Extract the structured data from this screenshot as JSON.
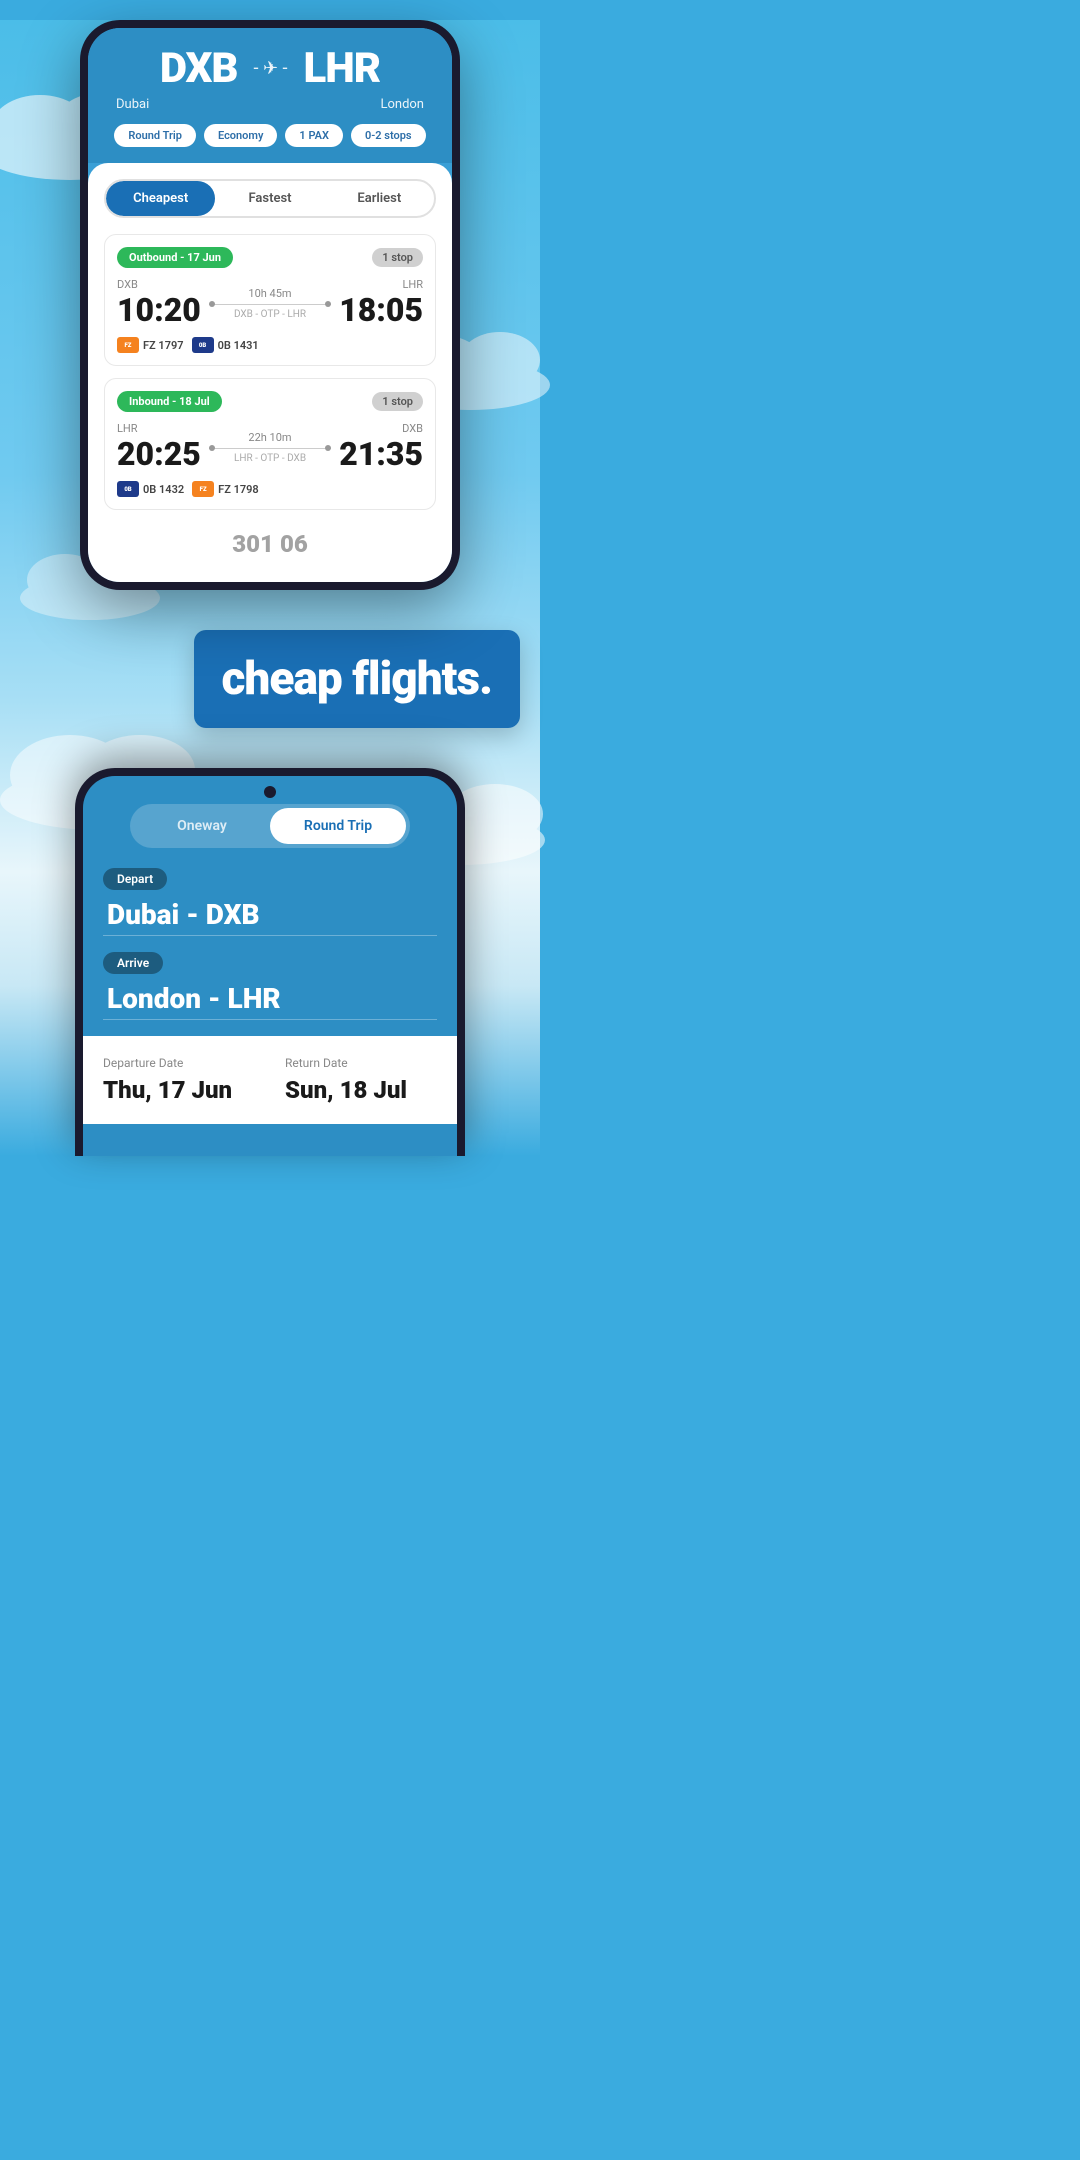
{
  "section1": {
    "phone": {
      "header": {
        "origin_code": "DXB",
        "origin_city": "Dubai",
        "destination_code": "LHR",
        "destination_city": "London",
        "plane_icon": "✈",
        "filters": {
          "trip_type": "Round Trip",
          "cabin": "Economy",
          "pax": "1 PAX",
          "stops": "0-2 stops"
        }
      },
      "tabs": {
        "cheapest": "Cheapest",
        "fastest": "Fastest",
        "earliest": "Earliest",
        "active": "cheapest"
      },
      "outbound": {
        "label": "Outbound - 17 Jun",
        "stop_badge": "1 stop",
        "origin": "DXB",
        "destination": "LHR",
        "depart_time": "10:20",
        "arrive_time": "18:05",
        "duration": "10h 45m",
        "route": "DXB - OTP - LHR",
        "airlines": [
          {
            "logo_class": "logo-dubai",
            "logo_text": "FZ",
            "flight": "FZ 1797"
          },
          {
            "logo_class": "logo-blue",
            "logo_text": "0B",
            "flight": "0B 1431"
          }
        ]
      },
      "inbound": {
        "label": "Inbound - 18 Jul",
        "stop_badge": "1 stop",
        "origin": "LHR",
        "destination": "DXB",
        "depart_time": "20:25",
        "arrive_time": "21:35",
        "duration": "22h 10m",
        "route": "LHR - OTP - DXB",
        "airlines": [
          {
            "logo_class": "logo-blue",
            "logo_text": "0B",
            "flight": "0B 1432"
          },
          {
            "logo_class": "logo-dubai",
            "logo_text": "FZ",
            "flight": "FZ 1798"
          }
        ]
      },
      "partial_price": "301 06"
    }
  },
  "middle": {
    "headline": "cheap flights."
  },
  "section2": {
    "phone": {
      "toggle": {
        "oneway": "Oneway",
        "round_trip": "Round Trip",
        "active": "round_trip"
      },
      "depart_label": "Depart",
      "depart_value": "Dubai - DXB",
      "arrive_label": "Arrive",
      "arrive_value": "London - LHR",
      "departure_date_label": "Departure Date",
      "departure_date_value": "Thu, 17 Jun",
      "return_date_label": "Return Date",
      "return_date_value": "Sun, 18 Jul"
    }
  }
}
